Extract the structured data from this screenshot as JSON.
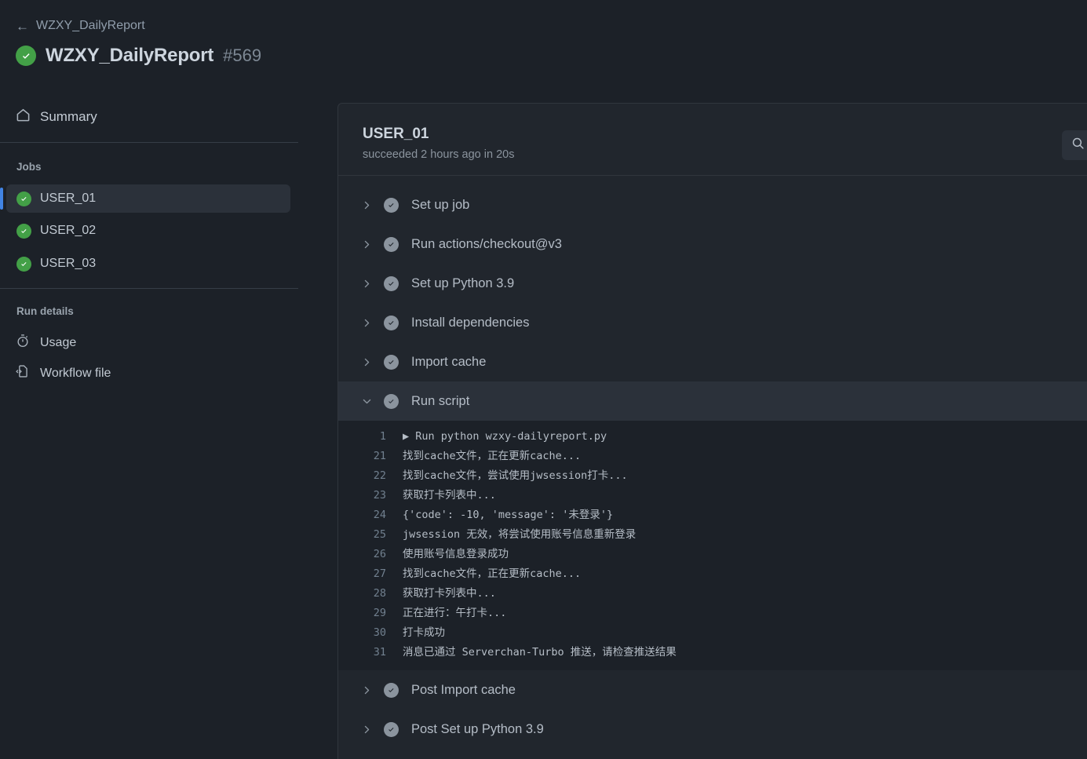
{
  "header": {
    "back_arrow": "←",
    "breadcrumb": "WZXY_DailyReport",
    "title": "WZXY_DailyReport",
    "run_number": "#569",
    "status_icon": "check-circle-green"
  },
  "sidebar": {
    "summary": {
      "label": "Summary",
      "icon": "home-icon"
    },
    "jobs_label": "Jobs",
    "jobs": [
      {
        "label": "USER_01",
        "status": "success",
        "selected": true
      },
      {
        "label": "USER_02",
        "status": "success",
        "selected": false
      },
      {
        "label": "USER_03",
        "status": "success",
        "selected": false
      }
    ],
    "run_details_label": "Run details",
    "run_details": [
      {
        "label": "Usage",
        "icon": "stopwatch-icon"
      },
      {
        "label": "Workflow file",
        "icon": "file-code-icon"
      }
    ]
  },
  "main": {
    "job_name": "USER_01",
    "job_meta": "succeeded 2 hours ago in 20s",
    "search_icon": "search-icon",
    "steps": [
      {
        "label": "Set up job",
        "expanded": false
      },
      {
        "label": "Run actions/checkout@v3",
        "expanded": false
      },
      {
        "label": "Set up Python 3.9",
        "expanded": false
      },
      {
        "label": "Install dependencies",
        "expanded": false
      },
      {
        "label": "Import cache",
        "expanded": false
      },
      {
        "label": "Run script",
        "expanded": true
      }
    ],
    "steps_after": [
      {
        "label": "Post Import cache",
        "expanded": false
      },
      {
        "label": "Post Set up Python 3.9",
        "expanded": false
      }
    ],
    "log": [
      {
        "n": "1",
        "text": "▶ Run python wzxy-dailyreport.py"
      },
      {
        "n": "21",
        "text": "找到cache文件，正在更新cache..."
      },
      {
        "n": "22",
        "text": "找到cache文件，尝试使用jwsession打卡..."
      },
      {
        "n": "23",
        "text": "获取打卡列表中..."
      },
      {
        "n": "24",
        "text": "{'code': -10, 'message': '未登录'}"
      },
      {
        "n": "25",
        "text": "jwsession 无效，将尝试使用账号信息重新登录"
      },
      {
        "n": "26",
        "text": "使用账号信息登录成功"
      },
      {
        "n": "27",
        "text": "找到cache文件，正在更新cache..."
      },
      {
        "n": "28",
        "text": "获取打卡列表中..."
      },
      {
        "n": "29",
        "text": "正在进行：午打卡..."
      },
      {
        "n": "30",
        "text": "打卡成功"
      },
      {
        "n": "31",
        "text": "消息已通过 Serverchan-Turbo 推送，请检查推送结果"
      }
    ]
  },
  "colors": {
    "page_bg": "#1c2128",
    "panel_bg": "#21262d",
    "success_green": "#43a047",
    "accent_blue": "#4184e4",
    "step_icon_gray": "#8b949e",
    "text_primary": "#cdd5de",
    "text_muted": "#8b949e"
  }
}
